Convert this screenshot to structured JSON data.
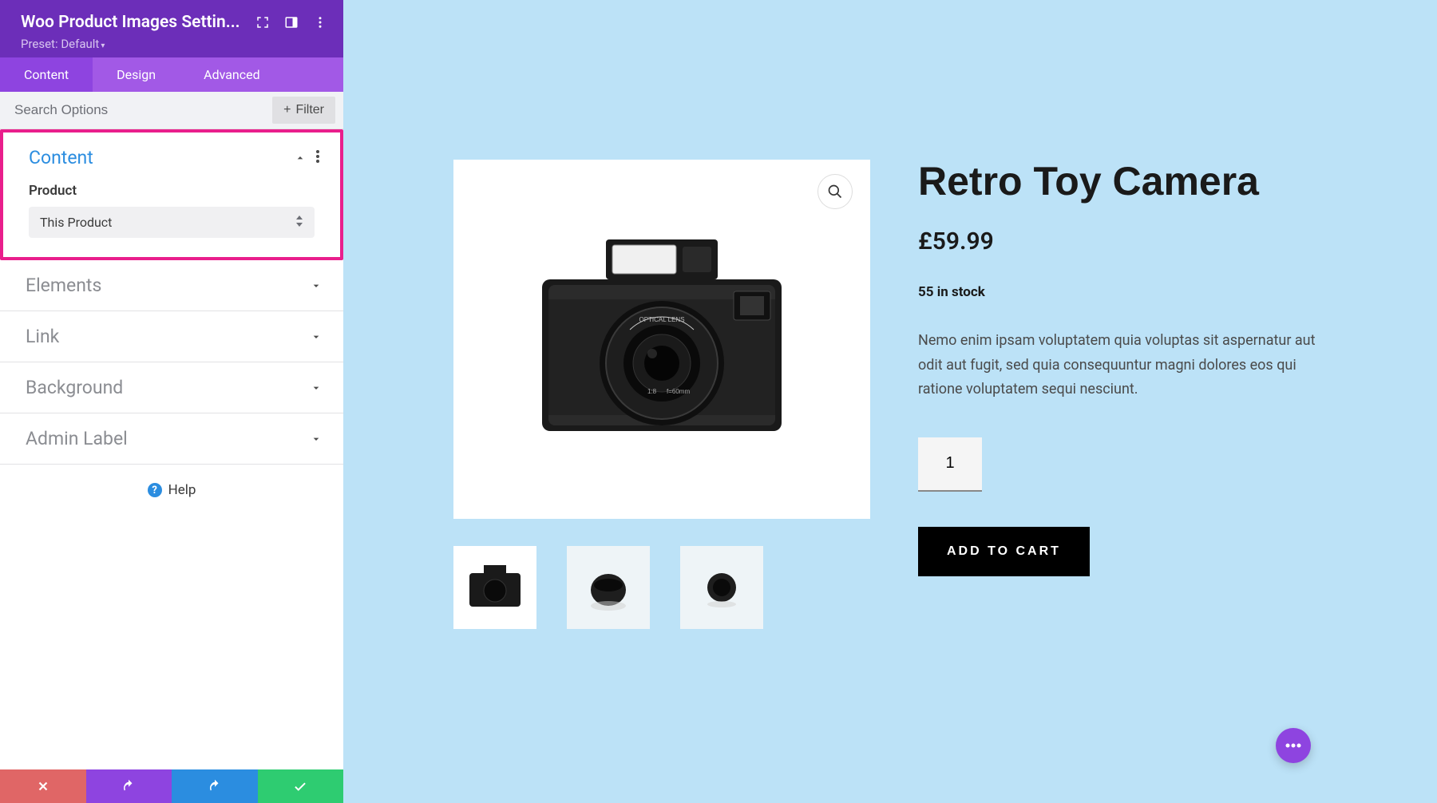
{
  "sidebar": {
    "title": "Woo Product Images Settin...",
    "preset_label": "Preset: Default",
    "tabs": [
      "Content",
      "Design",
      "Advanced"
    ],
    "search_placeholder": "Search Options",
    "filter_label": "Filter",
    "sections": {
      "content": {
        "title": "Content",
        "product_label": "Product",
        "product_value": "This Product"
      },
      "elements": {
        "title": "Elements"
      },
      "link": {
        "title": "Link"
      },
      "background": {
        "title": "Background"
      },
      "admin_label": {
        "title": "Admin Label"
      }
    },
    "help": "Help"
  },
  "product": {
    "title": "Retro Toy Camera",
    "price": "£59.99",
    "stock": "55 in stock",
    "description": "Nemo enim ipsam voluptatem quia voluptas sit aspernatur aut odit aut fugit, sed quia consequuntur magni dolores eos qui ratione voluptatem sequi nesciunt.",
    "quantity": "1",
    "add_to_cart": "ADD TO CART"
  }
}
